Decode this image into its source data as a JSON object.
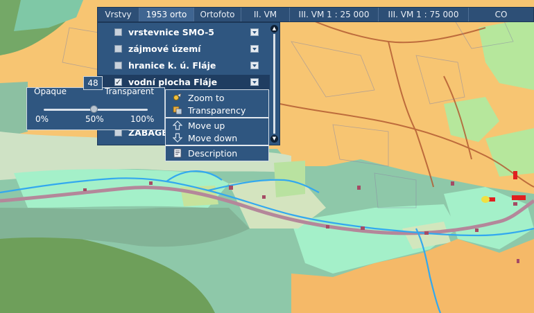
{
  "tabs": [
    {
      "label": "Vrstvy"
    },
    {
      "label": "1953 orto"
    },
    {
      "label": "Ortofoto"
    },
    {
      "label": "II. VM"
    },
    {
      "label": "III. VM 1 : 25 000"
    },
    {
      "label": "III. VM 1 : 75 000"
    },
    {
      "label": "CO"
    }
  ],
  "active_tab": "1953 orto",
  "layers": [
    {
      "label": "vrstevnice SMO-5",
      "checked": false
    },
    {
      "label": "zájmové území",
      "checked": false
    },
    {
      "label": "hranice k. ú. Fláje",
      "checked": false
    },
    {
      "label": "vodní plocha Fláje",
      "checked": true
    },
    {
      "label": "ZABAGE",
      "checked": false
    }
  ],
  "opacity": {
    "opaque_label": "Opaque",
    "transparent_label": "Transparent",
    "min_label": "0%",
    "mid_label": "50%",
    "max_label": "100%",
    "value": "48",
    "slider_fraction": 0.48
  },
  "context_menu": {
    "zoom_to": "Zoom to",
    "transparency": "Transparency",
    "move_up": "Move up",
    "move_down": "Move down",
    "description": "Description"
  },
  "colors": {
    "panel": "#2f5680",
    "panel_dark": "#1f3d61",
    "map_orange": "#f7c572",
    "map_green_dark": "#6e9f5a",
    "map_teal": "#7fc8a6",
    "map_mint": "#9eedc4",
    "river": "#32a8ef"
  }
}
